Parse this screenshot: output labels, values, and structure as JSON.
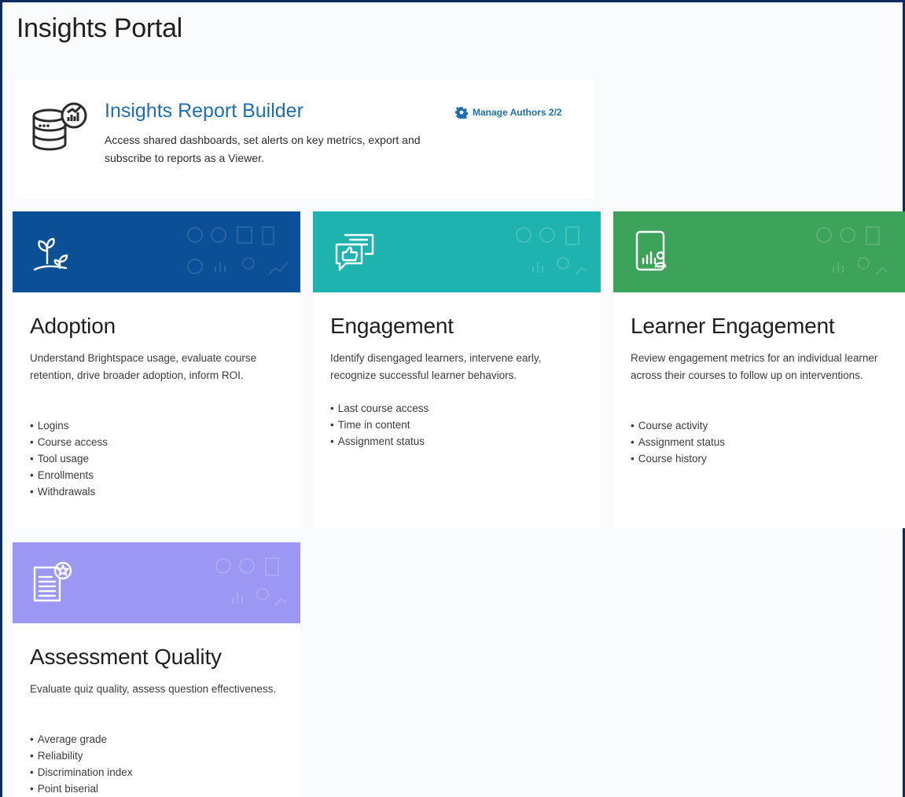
{
  "page": {
    "title": "Insights Portal"
  },
  "builder": {
    "title": "Insights Report Builder",
    "description": "Access shared dashboards, set alerts on key metrics, export and subscribe to reports as a Viewer.",
    "manage_label": "Manage Authors 2/2",
    "icon": "database-report-icon"
  },
  "colors": {
    "accent": "#1d6eb3",
    "adoption": "#0b4f96",
    "engagement": "#1fb3b0",
    "learner_engagement": "#3ea35a",
    "assessment_quality": "#9b97f2"
  },
  "tiles": [
    {
      "title": "Adoption",
      "icon": "sprout-icon",
      "description": "Understand Brightspace usage, evaluate course retention, drive broader adoption, inform ROI.",
      "items": [
        "Logins",
        "Course access",
        "Tool usage",
        "Enrollments",
        "Withdrawals"
      ]
    },
    {
      "title": "Engagement",
      "icon": "chat-thumbs-up-icon",
      "description": "Identify disengaged learners, intervene early, recognize successful learner behaviors.",
      "items": [
        "Last course access",
        "Time in content",
        "Assignment status"
      ]
    },
    {
      "title": "Learner Engagement",
      "icon": "tablet-chart-person-icon",
      "description": "Review engagement metrics for an individual learner across their courses to follow up on interventions.",
      "items": [
        "Course activity",
        "Assignment status",
        "Course history"
      ]
    },
    {
      "title": "Assessment Quality",
      "icon": "document-badge-icon",
      "description": "Evaluate quiz quality, assess question effectiveness.",
      "items": [
        "Average grade",
        "Reliability",
        "Discrimination index",
        "Point biserial"
      ]
    }
  ]
}
